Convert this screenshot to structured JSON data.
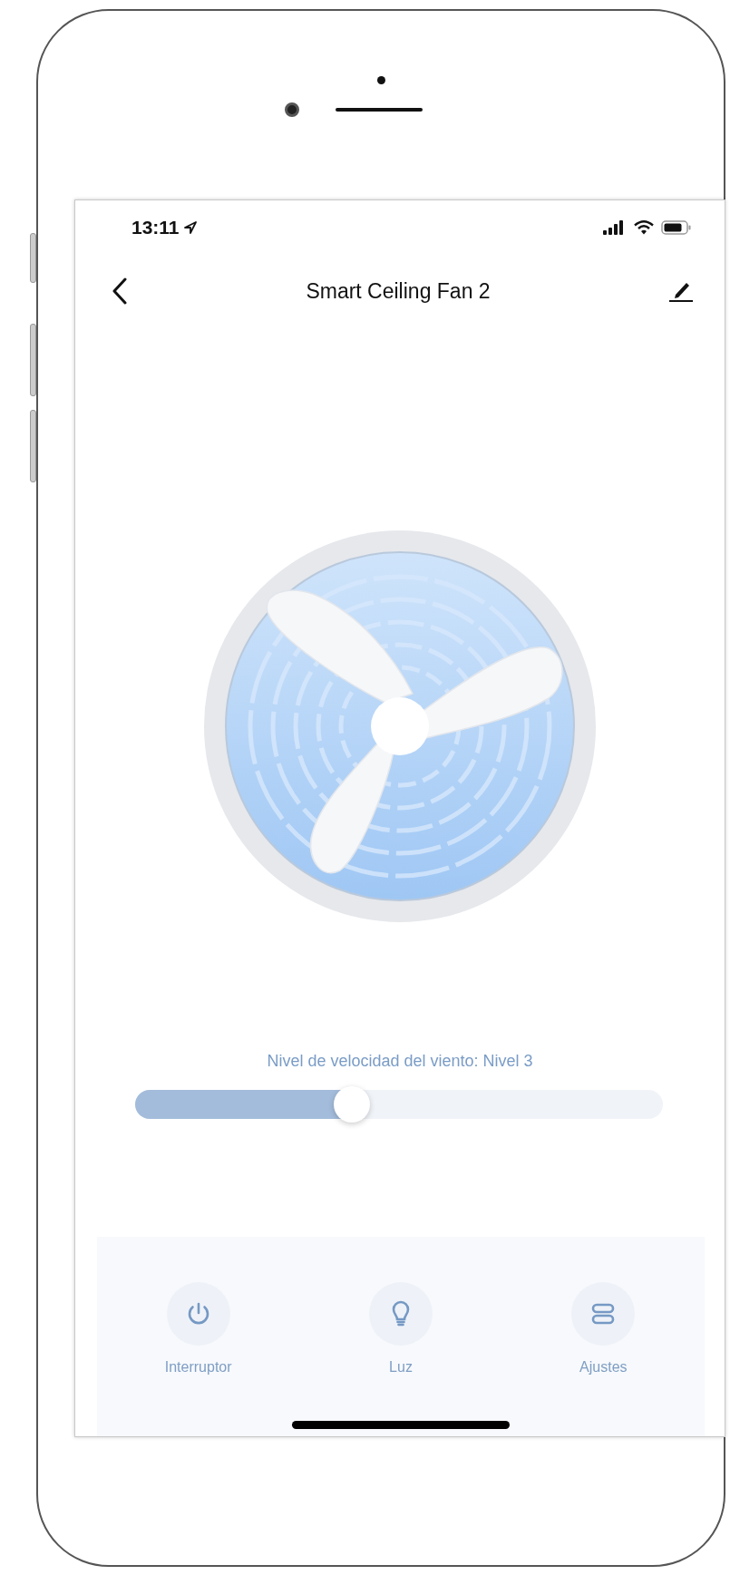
{
  "status_bar": {
    "time": "13:11"
  },
  "header": {
    "title": "Smart Ceiling Fan 2"
  },
  "speed": {
    "label": "Nivel de velocidad del viento: Nivel 3",
    "level": 0.41
  },
  "controls": [
    {
      "kind": "power",
      "label": "Interruptor"
    },
    {
      "kind": "light",
      "label": "Luz"
    },
    {
      "kind": "settings",
      "label": "Ajustes"
    }
  ]
}
